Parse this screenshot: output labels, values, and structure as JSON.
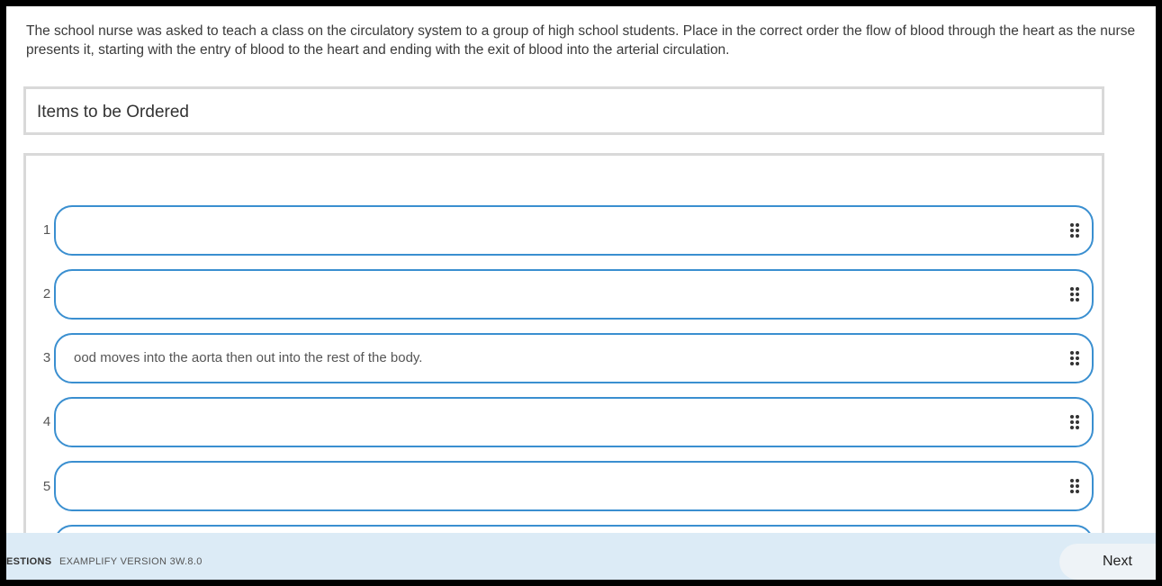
{
  "question": {
    "text": "The school nurse was asked to teach a class on the circulatory system to a group of high school students. Place in the correct order the flow of blood through the heart as the nurse presents it, starting with the entry of blood to the heart and ending with the exit of blood into the arterial circulation."
  },
  "items_panel": {
    "title": "Items to be Ordered"
  },
  "order_slots": [
    {
      "number": "1",
      "text": ""
    },
    {
      "number": "2",
      "text": ""
    },
    {
      "number": "3",
      "text": "ood moves into the aorta then out into the rest of the body."
    },
    {
      "number": "4",
      "text": ""
    },
    {
      "number": "5",
      "text": ""
    }
  ],
  "footer": {
    "questions_label": "ESTIONS",
    "version_label": "EXAMPLIFY VERSION 3W.8.0",
    "next_label": "Next"
  },
  "colors": {
    "slot_border": "#3a8fd0",
    "footer_bg": "#dcebf6",
    "panel_border": "#d9d9d9"
  }
}
